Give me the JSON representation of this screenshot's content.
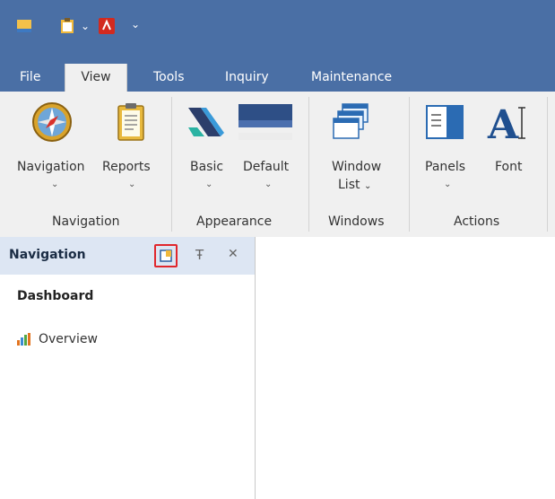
{
  "qat": {
    "icons": [
      "app-icon",
      "clipboard-icon",
      "dropdown-chevron-icon",
      "pdf-icon",
      "customize-dropdown-icon"
    ]
  },
  "tabs": [
    {
      "label": "File"
    },
    {
      "label": "View",
      "active": true
    },
    {
      "label": "Tools"
    },
    {
      "label": "Inquiry"
    },
    {
      "label": "Maintenance"
    }
  ],
  "ribbon": {
    "groups": {
      "navigation": "Navigation",
      "appearance": "Appearance",
      "windows": "Windows",
      "actions": "Actions"
    },
    "buttons": {
      "navigation": "Navigation",
      "reports": "Reports",
      "basic": "Basic",
      "default": "Default",
      "window_list_1": "Window",
      "window_list_2": "List",
      "panels": "Panels",
      "font": "Font"
    },
    "chevron": "⌄"
  },
  "nav_panel": {
    "title": "Navigation",
    "pin_glyph": "Ŧ",
    "close_glyph": "✕",
    "section": "Dashboard",
    "items": [
      {
        "label": "Overview"
      }
    ]
  },
  "colors": {
    "title_bar": "#4a6fa5",
    "ribbon_bg": "#f0f0f0",
    "panel_header": "#dde6f3",
    "highlight": "#e0262c"
  }
}
